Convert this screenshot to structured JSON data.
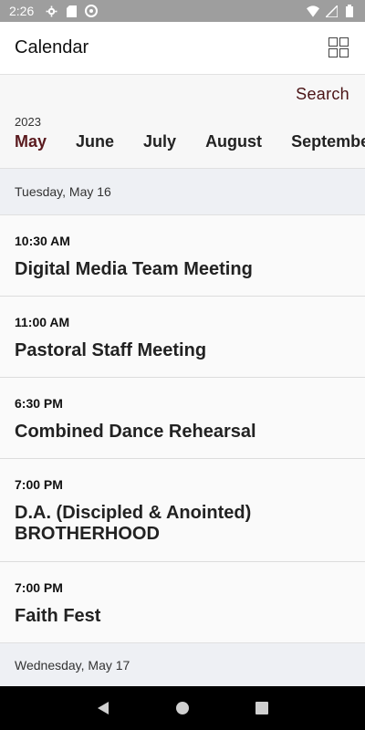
{
  "status_bar": {
    "time": "2:26",
    "icons": [
      "gear-icon",
      "sd-card-icon",
      "at-sign-icon"
    ],
    "right_icons": [
      "wifi-icon",
      "signal-icon",
      "battery-icon"
    ]
  },
  "app_bar": {
    "title": "Calendar",
    "grid_icon": "grid-icon"
  },
  "month_selector": {
    "search_label": "Search",
    "year": "2023",
    "months": [
      "May",
      "June",
      "July",
      "August",
      "September"
    ],
    "active_month": "May"
  },
  "days": [
    {
      "label": "Tuesday, May 16",
      "events": [
        {
          "time": "10:30 AM",
          "title": "Digital Media Team Meeting"
        },
        {
          "time": "11:00 AM",
          "title": "Pastoral Staff Meeting"
        },
        {
          "time": "6:30 PM",
          "title": "Combined Dance Rehearsal"
        },
        {
          "time": "7:00 PM",
          "title": "D.A. (Discipled & Anointed) BROTHERHOOD"
        },
        {
          "time": "7:00 PM",
          "title": "Faith Fest"
        }
      ]
    },
    {
      "label": "Wednesday, May 17",
      "events": []
    }
  ],
  "colors": {
    "accent": "#5a1a1e",
    "search": "#4a1416",
    "status_bar": "#9e9e9e",
    "day_header": "#eef0f4"
  }
}
